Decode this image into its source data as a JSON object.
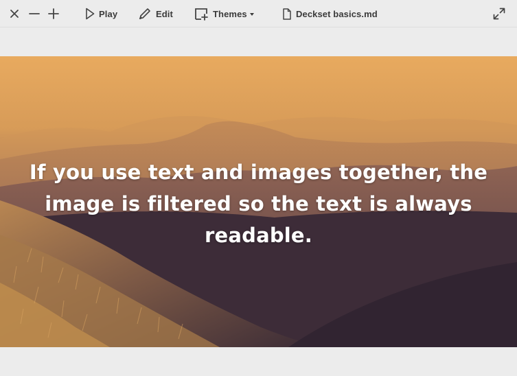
{
  "toolbar": {
    "close_icon": "close-icon",
    "zoom_out_icon": "minus-icon",
    "zoom_in_icon": "plus-icon",
    "play_label": "Play",
    "edit_label": "Edit",
    "themes_label": "Themes",
    "document_title": "Deckset basics.md",
    "expand_icon": "fullscreen-icon"
  },
  "slide": {
    "text": "If you use text and images together, the image is filtered so the text is always readable.",
    "background_image": "mountain-landscape-photo",
    "filter_color_top": "#e8a95e",
    "filter_color_bottom": "#3a2a38"
  }
}
